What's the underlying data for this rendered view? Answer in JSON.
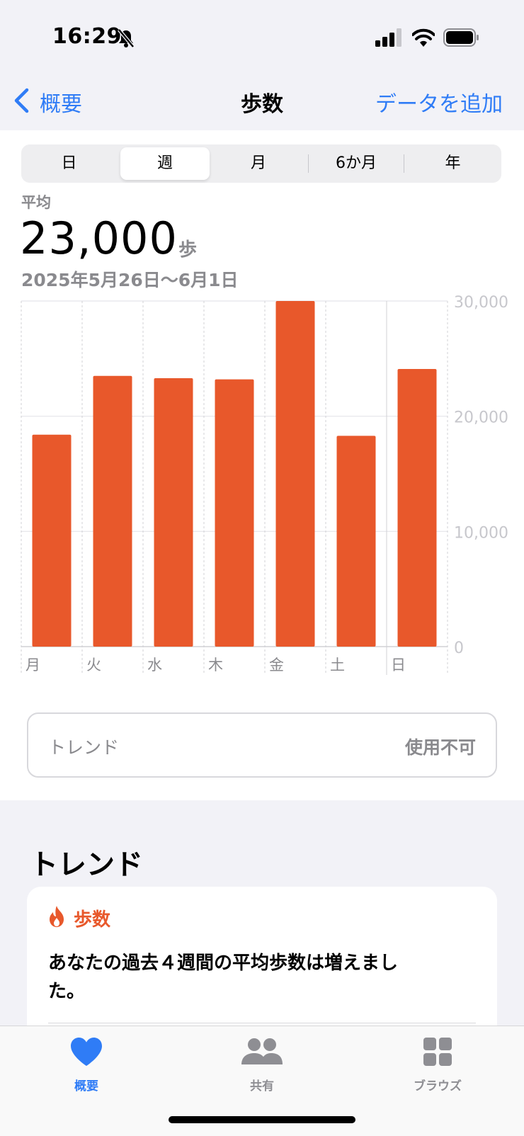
{
  "status": {
    "time": "16:29"
  },
  "nav": {
    "back_label": "概要",
    "title": "歩数",
    "add_data": "データを追加"
  },
  "segments": [
    {
      "label": "日"
    },
    {
      "label": "週",
      "selected": true
    },
    {
      "label": "月"
    },
    {
      "label": "6か月"
    },
    {
      "label": "年"
    }
  ],
  "summary": {
    "label": "平均",
    "value": "23,000",
    "unit": "歩",
    "date_range": "2025年5月26日〜6月1日"
  },
  "chart_data": {
    "type": "bar",
    "categories": [
      "月",
      "火",
      "水",
      "木",
      "金",
      "土",
      "日"
    ],
    "values": [
      18400,
      23500,
      23300,
      23200,
      30000,
      18300,
      24100
    ],
    "ylim": [
      0,
      30000
    ],
    "yticks": [
      "0",
      "10,000",
      "20,000",
      "30,000"
    ],
    "ytick_values": [
      0,
      10000,
      20000,
      30000
    ],
    "color": "#e8582b",
    "grid": true
  },
  "trend_box": {
    "label": "トレンド",
    "value": "使用不可"
  },
  "trends_section": {
    "title": "トレンド",
    "card_title": "歩数",
    "card_text": "あなたの過去４週間の平均歩数は増えました。",
    "accent": "#e8582b"
  },
  "tabbar": [
    {
      "label": "概要",
      "icon": "heart-icon",
      "active": true
    },
    {
      "label": "共有",
      "icon": "people-icon",
      "active": false
    },
    {
      "label": "ブラウズ",
      "icon": "grid-icon",
      "active": false
    }
  ],
  "colors": {
    "accent_blue": "#2f7cf6",
    "bar": "#e8582b"
  }
}
